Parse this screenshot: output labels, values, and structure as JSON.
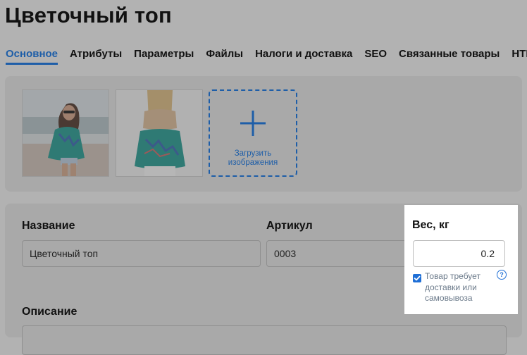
{
  "page": {
    "title": "Цветочный топ"
  },
  "tabs": [
    {
      "label": "Основное",
      "active": true
    },
    {
      "label": "Атрибуты"
    },
    {
      "label": "Параметры"
    },
    {
      "label": "Файлы"
    },
    {
      "label": "Налоги и доставка"
    },
    {
      "label": "SEO"
    },
    {
      "label": "Связанные товары"
    },
    {
      "label": "HTML-"
    }
  ],
  "images": {
    "upload_label": "Загрузить изображения",
    "upload_icon": "plus-icon"
  },
  "form": {
    "name_label": "Название",
    "name_value": "Цветочный топ",
    "sku_label": "Артикул",
    "sku_value": "0003",
    "description_label": "Описание"
  },
  "weight": {
    "label": "Вес, кг",
    "value": "0.2",
    "requires_shipping_label": "Товар требует доставки или самовывоза",
    "requires_shipping_checked": true,
    "help_icon": "question-circle-icon",
    "help_glyph": "?"
  },
  "colors": {
    "accent": "#1e5ea8",
    "checkbox": "#1f6fd6",
    "overlay": "#b2b2b2"
  }
}
